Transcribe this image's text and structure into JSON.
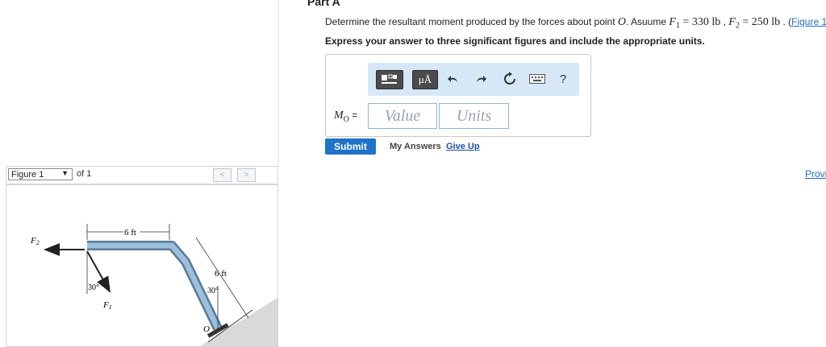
{
  "part_title": "Part A",
  "question": {
    "prefix": "Determine the resultant moment produced by the forces about point ",
    "point": "O",
    "mid": ". Asuume ",
    "f1_label": "F",
    "f1_sub": "1",
    "f1_value": " = 330 lb",
    "sep": " , ",
    "f2_label": "F",
    "f2_sub": "2",
    "f2_value": " = 250 lb",
    "suffix": " . (",
    "figure_link": "Figure 1",
    "close": ")"
  },
  "instruction": "Express your answer to three significant figures and include the appropriate units.",
  "toolbar": {
    "units_button": "μÅ",
    "help_button": "?"
  },
  "answer": {
    "label_main": "M",
    "label_sub": "O",
    "label_eq": " =",
    "value_placeholder": "Value",
    "units_placeholder": "Units"
  },
  "actions": {
    "submit": "Submit",
    "my_answers": "My Answers",
    "give_up": "Give Up",
    "provide": "Provi"
  },
  "figure_nav": {
    "selected": "Figure 1",
    "of_text": "of 1",
    "prev": "<",
    "next": ">"
  },
  "figure": {
    "f2": "F",
    "f2_sub": "2",
    "f1": "F",
    "f1_sub": "1",
    "dim_top": "6 ft",
    "dim_side": "6 ft",
    "angle_left": "30°",
    "angle_right": "30°",
    "point": "O"
  }
}
